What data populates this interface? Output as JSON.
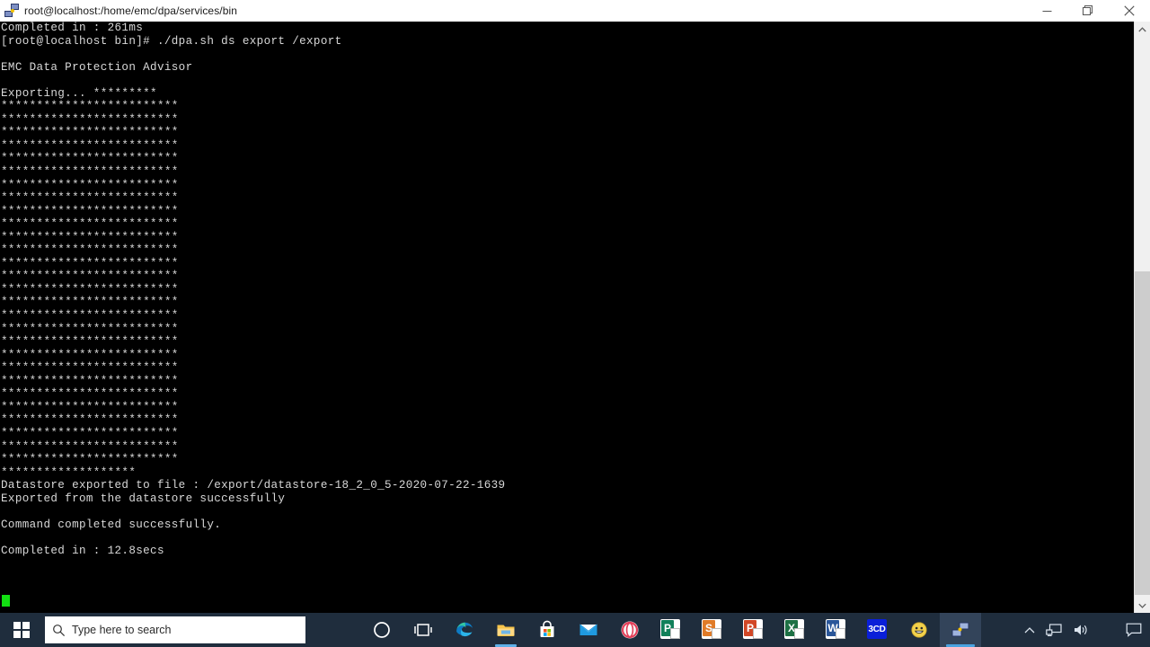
{
  "window": {
    "title": "root@localhost:/home/emc/dpa/services/bin",
    "icon": "putty-icon",
    "controls": {
      "minimize": "minimize-button",
      "restore": "restore-button",
      "close": "close-button"
    }
  },
  "terminal": {
    "foreground": "#d8d8d8",
    "background": "#000000",
    "cursor_color": "#12e012",
    "lines": [
      "Completed in : 261ms",
      "[root@localhost bin]# ./dpa.sh ds export /export",
      "",
      "EMC Data Protection Advisor",
      "",
      "Exporting... *********",
      "*************************",
      "*************************",
      "*************************",
      "*************************",
      "*************************",
      "*************************",
      "*************************",
      "*************************",
      "*************************",
      "*************************",
      "*************************",
      "*************************",
      "*************************",
      "*************************",
      "*************************",
      "*************************",
      "*************************",
      "*************************",
      "*************************",
      "*************************",
      "*************************",
      "*************************",
      "*************************",
      "*************************",
      "*************************",
      "*************************",
      "*************************",
      "*************************",
      "*******************",
      "Datastore exported to file : /export/datastore-18_2_0_5-2020-07-22-1639",
      "Exported from the datastore successfully",
      "",
      "Command completed successfully.",
      "",
      "Completed in : 12.8secs"
    ]
  },
  "scrollbar": {
    "up_arrow": "scroll-up-arrow",
    "down_arrow": "scroll-down-arrow",
    "thumb": "scroll-thumb"
  },
  "taskbar": {
    "background": "#1f2d3d",
    "start_button": "windows-start-icon",
    "search": {
      "placeholder": "Type here to search",
      "icon": "search-icon"
    },
    "items": [
      {
        "name": "cortana-icon",
        "label": "Cortana",
        "state": "idle"
      },
      {
        "name": "task-view-icon",
        "label": "Task View",
        "state": "idle"
      },
      {
        "name": "edge-icon",
        "label": "Microsoft Edge",
        "state": "idle"
      },
      {
        "name": "file-explorer-icon",
        "label": "File Explorer",
        "state": "running"
      },
      {
        "name": "microsoft-store-icon",
        "label": "Microsoft Store",
        "state": "idle"
      },
      {
        "name": "mail-icon",
        "label": "Mail",
        "state": "idle"
      },
      {
        "name": "opera-icon",
        "label": "Opera",
        "state": "idle"
      },
      {
        "name": "publisher-icon",
        "label": "Publisher",
        "state": "idle"
      },
      {
        "name": "sway-icon",
        "label": "Sway",
        "state": "idle"
      },
      {
        "name": "powerpoint-icon",
        "label": "PowerPoint",
        "state": "idle"
      },
      {
        "name": "excel-icon",
        "label": "Excel",
        "state": "idle"
      },
      {
        "name": "word-icon",
        "label": "Word",
        "state": "idle"
      },
      {
        "name": "threecd-icon",
        "label": "3CD",
        "state": "idle"
      },
      {
        "name": "smiley-icon",
        "label": "Smiley",
        "state": "idle"
      },
      {
        "name": "putty-taskbar-icon",
        "label": "PuTTY",
        "state": "active"
      }
    ],
    "tray": [
      {
        "name": "show-hidden-icons-chevron",
        "label": "Show hidden icons"
      },
      {
        "name": "network-icon",
        "label": "Network"
      },
      {
        "name": "volume-icon",
        "label": "Volume"
      }
    ],
    "action_center": "action-center-icon",
    "tile_labels": {
      "threecd": "3CD",
      "publisher": "P",
      "sway": "S",
      "powerpoint": "P",
      "excel": "X",
      "word": "W"
    }
  }
}
